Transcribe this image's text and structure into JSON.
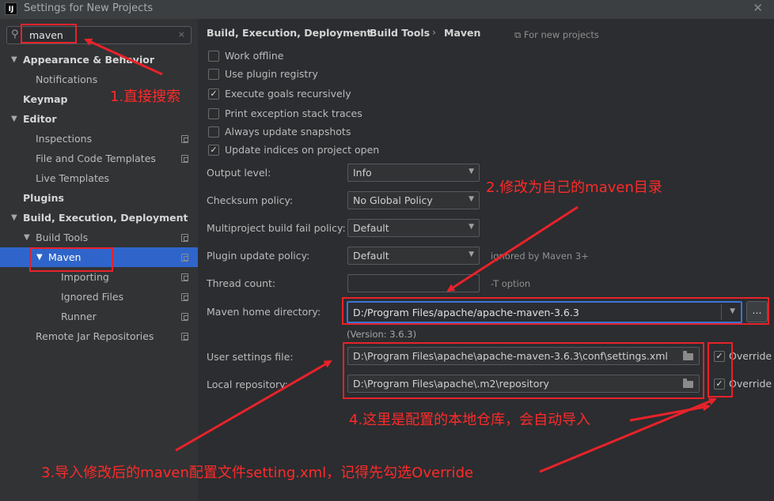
{
  "window": {
    "logo": "IJ",
    "title": "Settings for New Projects",
    "close_glyph": "✕"
  },
  "search": {
    "value": "maven",
    "icon": "search-icon",
    "clear_glyph": "×"
  },
  "sidebar": {
    "items": [
      {
        "label": "Appearance & Behavior",
        "bold": true,
        "expanded": true
      },
      {
        "label": "Notifications"
      },
      {
        "label": "Keymap",
        "bold": true
      },
      {
        "label": "Editor",
        "bold": true,
        "expanded": true
      },
      {
        "label": "Inspections"
      },
      {
        "label": "File and Code Templates"
      },
      {
        "label": "Live Templates"
      },
      {
        "label": "Plugins",
        "bold": true
      },
      {
        "label": "Build, Execution, Deployment",
        "bold": true,
        "expanded": true
      },
      {
        "label": "Build Tools",
        "expanded": true
      },
      {
        "label": "Maven",
        "selected": true,
        "expanded": true
      },
      {
        "label": "Importing"
      },
      {
        "label": "Ignored Files"
      },
      {
        "label": "Runner"
      },
      {
        "label": "Remote Jar Repositories"
      }
    ]
  },
  "breadcrumb": {
    "items": [
      "Build, Execution, Deployment",
      "Build Tools",
      "Maven"
    ],
    "separator": "›",
    "scope": "For new projects"
  },
  "checkboxes": [
    {
      "label": "Work offline",
      "checked": false
    },
    {
      "label": "Use plugin registry",
      "checked": false
    },
    {
      "label": "Execute goals recursively",
      "checked": true
    },
    {
      "label": "Print exception stack traces",
      "checked": false
    },
    {
      "label": "Always update snapshots",
      "checked": false
    },
    {
      "label": "Update indices on project open",
      "checked": true
    }
  ],
  "form": {
    "output_level": {
      "label": "Output level:",
      "value": "Info"
    },
    "checksum_policy": {
      "label": "Checksum policy:",
      "value": "No Global Policy"
    },
    "multiproject_fail": {
      "label": "Multiproject build fail policy:",
      "value": "Default"
    },
    "plugin_update": {
      "label": "Plugin update policy:",
      "value": "Default",
      "hint": "ignored by Maven 3+"
    },
    "thread_count": {
      "label": "Thread count:",
      "value": "",
      "hint": "-T option"
    },
    "maven_home": {
      "label": "Maven home directory:",
      "value": "D:/Program Files/apache/apache-maven-3.6.3",
      "browse": "..."
    },
    "version": "(Version: 3.6.3)",
    "user_settings": {
      "label": "User settings file:",
      "value": "D:\\Program Files\\apache\\apache-maven-3.6.3\\conf\\settings.xml",
      "override_label": "Override",
      "override": true
    },
    "local_repo": {
      "label": "Local repository:",
      "value": "D:\\Program Files\\apache\\.m2\\repository",
      "override_label": "Override",
      "override": true
    }
  },
  "annotations": {
    "step1": "1.直接搜索",
    "step2": "2.修改为自己的maven目录",
    "step3": "3.导入修改后的maven配置文件setting.xml，记得先勾选Override",
    "step4": "4.这里是配置的本地仓库，会自动导入",
    "color": "#ff2a2a"
  },
  "colors": {
    "selection": "#2f65ca",
    "focus_border": "#3875d7",
    "background": "#2b2d30",
    "sidebar": "#313335"
  }
}
